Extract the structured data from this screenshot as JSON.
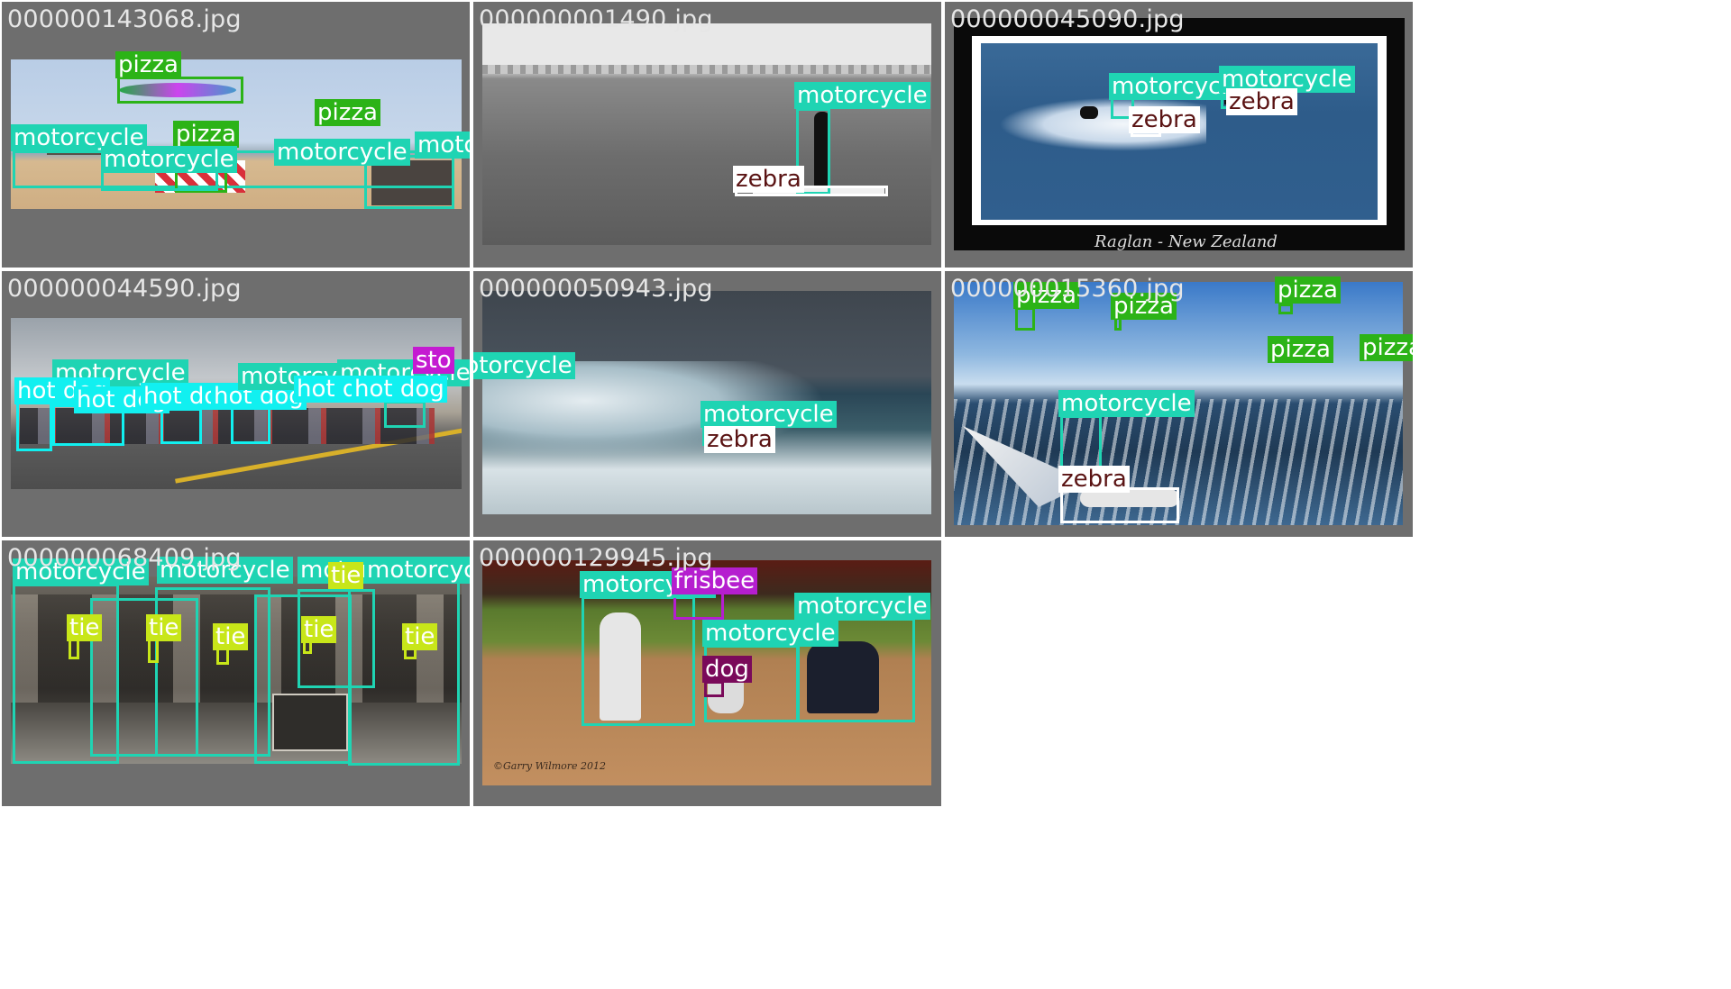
{
  "tiles": [
    {
      "filename": "000000143068.jpg"
    },
    {
      "filename": "000000001490.jpg"
    },
    {
      "filename": "000000045090.jpg",
      "credit": "Raglan - New Zealand"
    },
    {
      "filename": "000000044590.jpg"
    },
    {
      "filename": "000000050943.jpg"
    },
    {
      "filename": "000000015360.jpg"
    },
    {
      "filename": "000000068409.jpg"
    },
    {
      "filename": "000000129945.jpg",
      "credit": "©Garry Wilmore 2012"
    }
  ],
  "classes": {
    "pizza": {
      "label": "pizza",
      "color": "#2cb317"
    },
    "motorcycle": {
      "label": "motorcycle",
      "color": "#1fd4b3"
    },
    "zebra": {
      "label": "zebra",
      "color": "#ffffff",
      "text_color": "#7a1616"
    },
    "hot_dog": {
      "label": "hot dog",
      "color": "#11f0f0"
    },
    "tie": {
      "label": "tie",
      "color": "#c8e619"
    },
    "frisbee": {
      "label": "frisbee",
      "color": "#b51ecf"
    },
    "dog": {
      "label": "dog",
      "color": "#7a0a5a"
    },
    "stop_sign": {
      "label": "sto",
      "color": "#c41ad1"
    }
  }
}
